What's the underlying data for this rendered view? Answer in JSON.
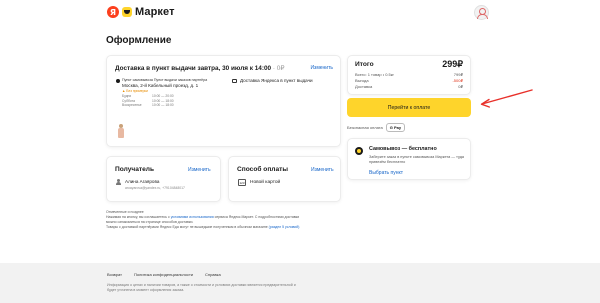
{
  "header": {
    "logo_badge": "Я",
    "logo_text": "Маркет"
  },
  "page": {
    "title": "Оформление"
  },
  "delivery": {
    "title": "Доставка в пункт выдачи завтра, 30 июля к 14:00",
    "price": "· 0₽",
    "change_label": "Изменить",
    "pvz_note": "Пункт самовывоза Пункт выдачи заказов партнёра",
    "address": "Москва, 2-й Кабельный проезд, д. 1",
    "badge": "▲ Без примерки",
    "hours": [
      {
        "days": "Будни",
        "time": "10:00 — 20:00"
      },
      {
        "days": "Суббота",
        "time": "10:00 — 18:00"
      },
      {
        "days": "Воскресенье",
        "time": "10:00 — 18:00"
      }
    ],
    "courier_label": "Доставка Яндекса в пункт выдачи"
  },
  "recipient": {
    "title": "Получатель",
    "change_label": "Изменить",
    "name": "Алина Агаярова",
    "contact": "aroayarova@yandex.ru, +79104848017"
  },
  "payment": {
    "title": "Способ оплаты",
    "change_label": "Изменить",
    "card_icon_text": "123",
    "method": "Новой картой"
  },
  "terms": {
    "heading": "Отмеченные и позднее",
    "line1_a": "Нажимая на кнопку, вы соглашаетесь с ",
    "line1_link": "условиями использования",
    "line1_b": " сервиса Яндекс.Маркет. С подробностями доставки",
    "line2": "можно ознакомиться на странице способов доставки.",
    "line3_a": "Товары с доставкой партнёрами Яндекс Еда могут не вышедшие полученным в обычном магазине ",
    "line3_link": "(раздел 5 условий)"
  },
  "summary": {
    "title": "Итого",
    "total": "299₽",
    "lines": [
      {
        "label": "Всего: 1 товар • 0.5кг",
        "value": "799₽",
        "kind": "normal"
      },
      {
        "label": "Выгода",
        "value": "-500₽",
        "kind": "benefit"
      },
      {
        "label": "Доставка",
        "value": "0₽",
        "kind": "normal"
      }
    ]
  },
  "checkout": {
    "pay_button": "Перейти к оплате",
    "methods_label": "Безопасная оплата",
    "gpay_label": "G Pay"
  },
  "promo": {
    "title": "Самовывоз — бесплатно",
    "desc": "Заберите заказ в пункте самовывоза Маркета — туда привезём бесплатно",
    "pick_label": "Выбрать пункт"
  },
  "footer": {
    "links": [
      "Возврат",
      "Политика конфиденциальности",
      "Справка"
    ],
    "info": "Информация о ценах и наличии товаров, а также о стоимости и условиях доставки является предварительной и будет уточнена в момент оформления заказа."
  },
  "colors": {
    "accent_yellow": "#fed42b",
    "link_blue": "#1766c9",
    "benefit_red": "#e0341a",
    "annotation_arrow": "#e8302a"
  },
  "icons": [
    "yandex-logo",
    "market-logo",
    "user-avatar",
    "pickup-point-icon",
    "courier-icon",
    "person-icon",
    "card-icon",
    "gpay-icon",
    "promo-icon",
    "arrow-annotation"
  ]
}
